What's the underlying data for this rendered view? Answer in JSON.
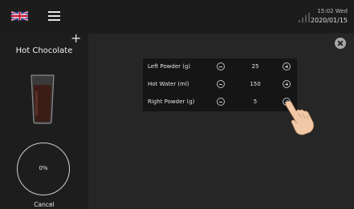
{
  "topbar": {
    "language_icon": "uk-flag-icon",
    "menu_icon": "hamburger-menu-icon",
    "signal_icon": "signal-strength-icon",
    "time": "15:02 Wed",
    "date": "2020/01/15"
  },
  "drink": {
    "add_icon": "plus-icon",
    "name": "Hot Chocolate",
    "progress": "0%",
    "progress_fraction": 0,
    "cancel_label": "Cancel"
  },
  "settings": {
    "close_icon": "close-icon",
    "rows": [
      {
        "label": "Left Powder (g)",
        "value": "25"
      },
      {
        "label": "Hot Water (ml)",
        "value": "150"
      },
      {
        "label": "Right Powder (g)",
        "value": "5"
      }
    ]
  },
  "colors": {
    "background": "#1b1b1b",
    "panel": "#151515",
    "main": "#262626"
  }
}
